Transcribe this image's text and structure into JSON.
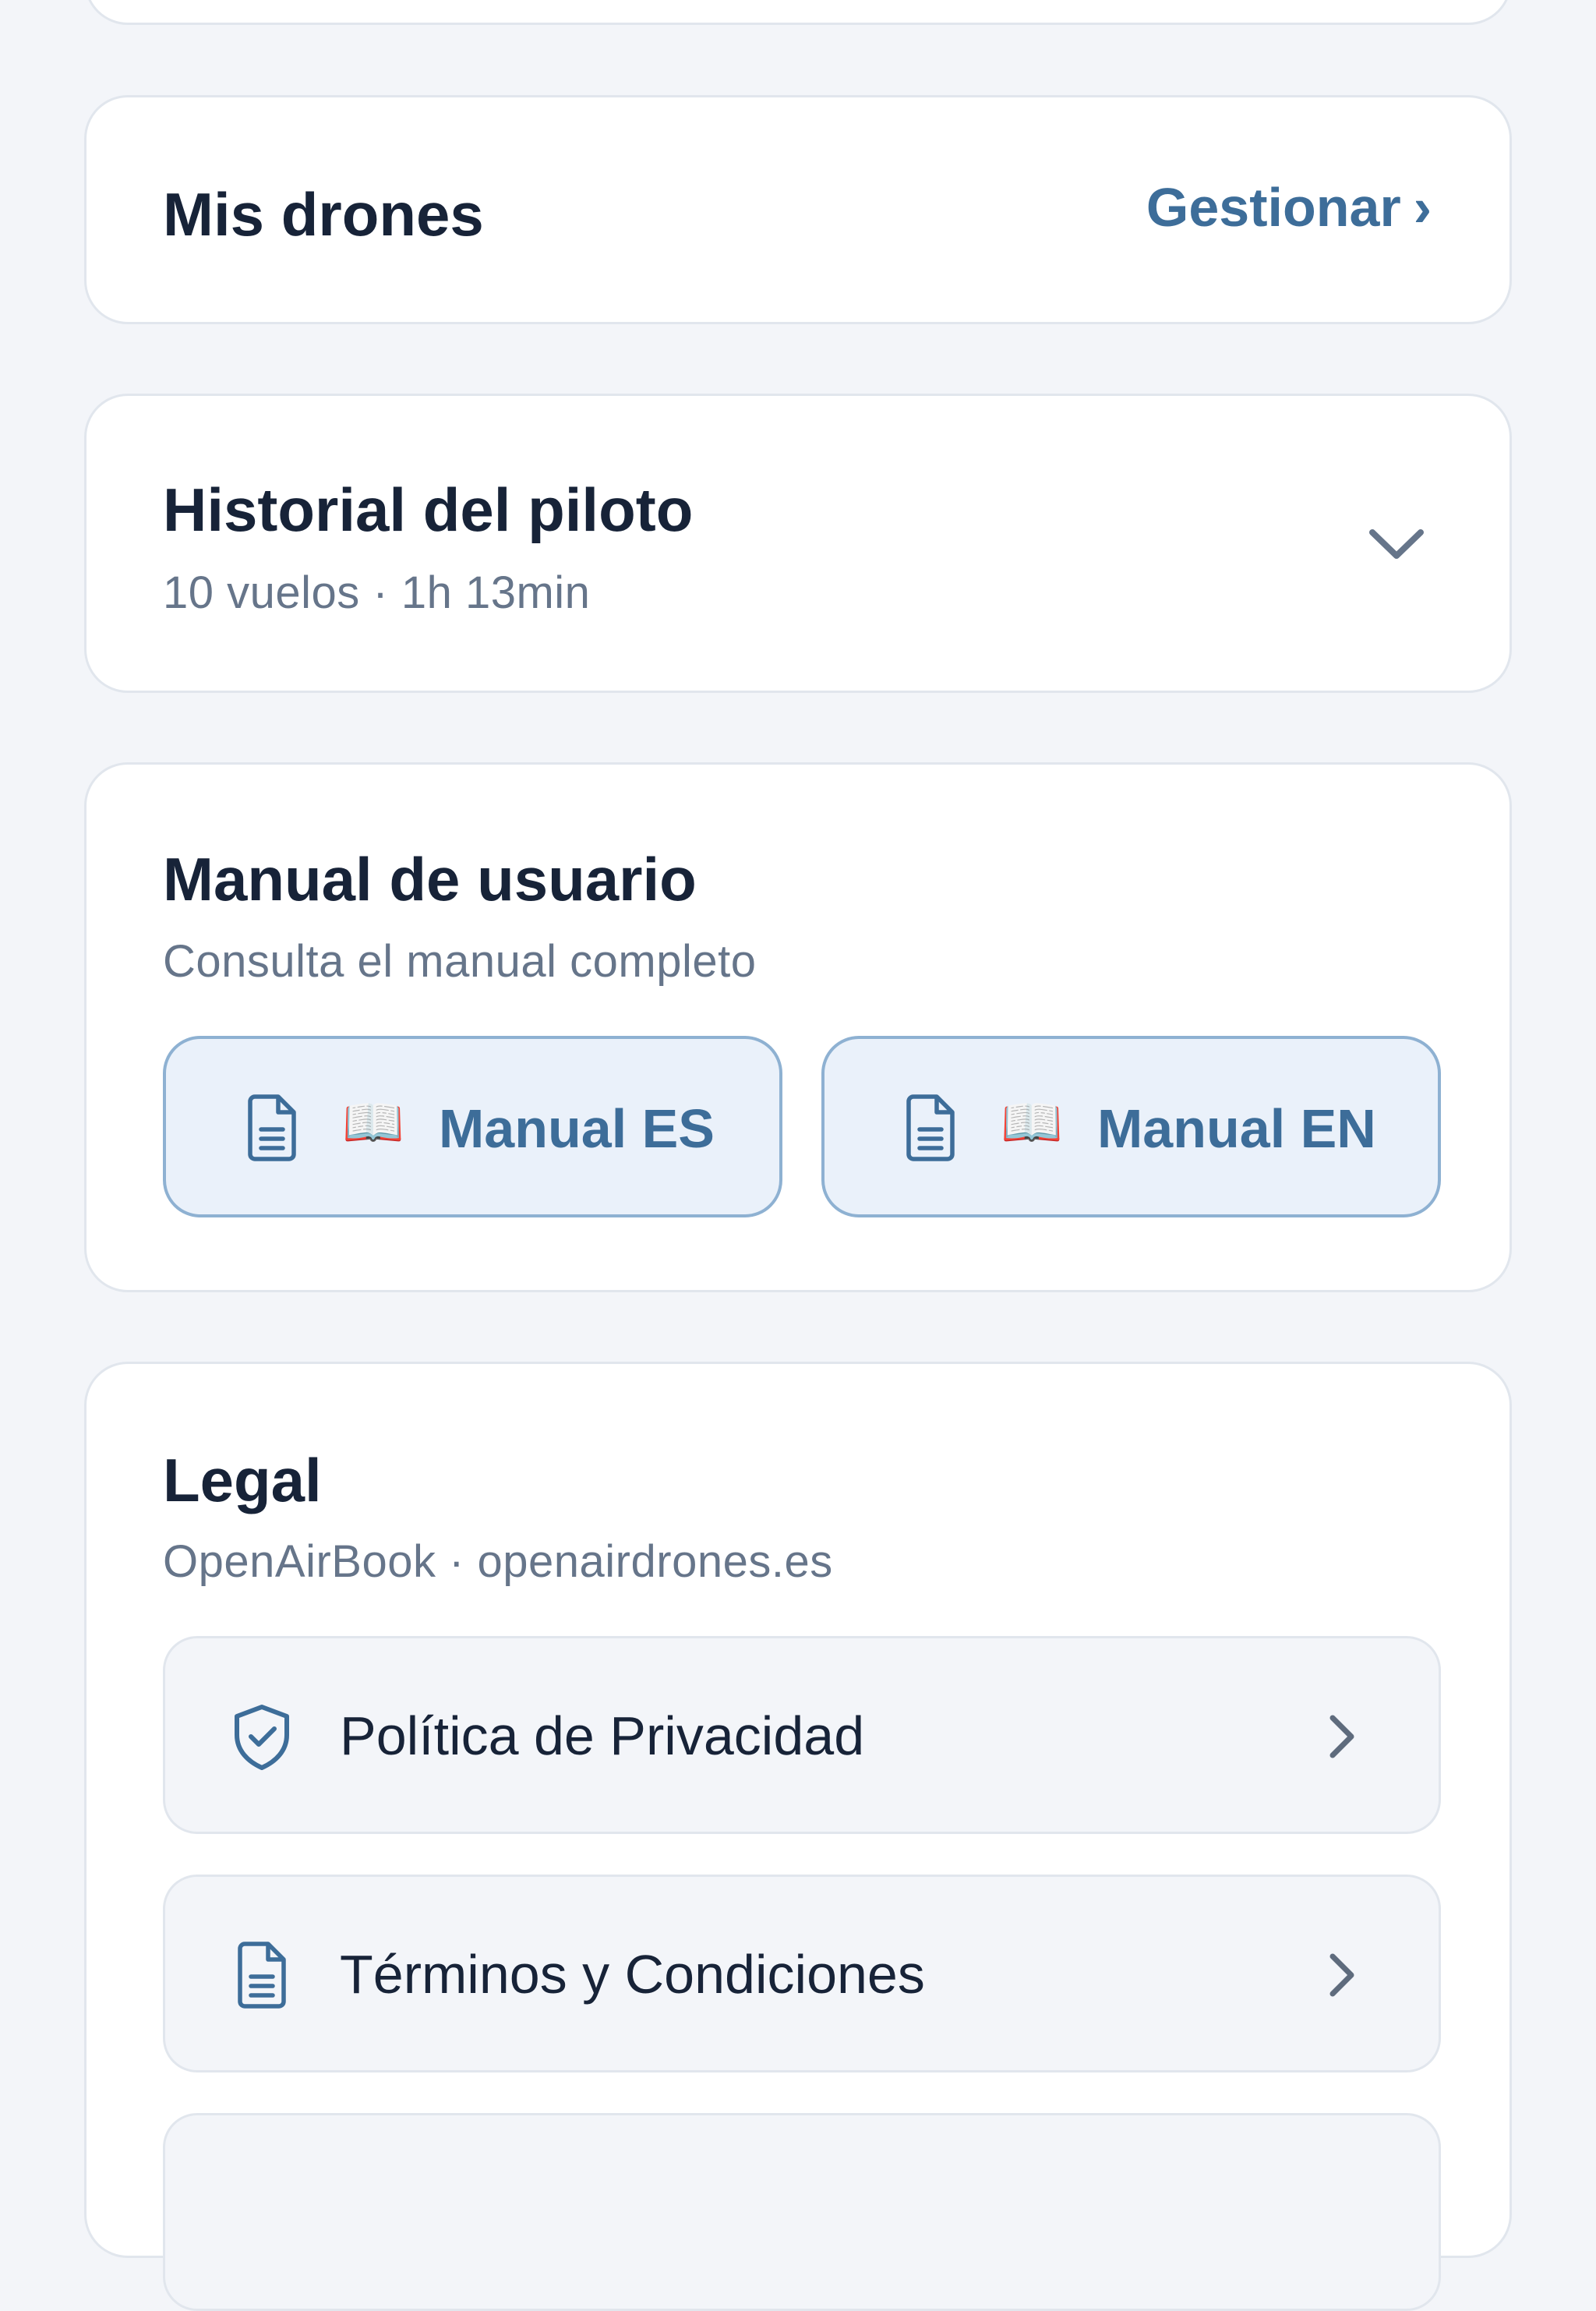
{
  "drones": {
    "title": "Mis drones",
    "manage_label": "Gestionar",
    "manage_chevron": "›"
  },
  "history": {
    "title": "Historial del piloto",
    "summary": "10 vuelos · 1h 13min",
    "toggle_icon": "chevron-down-icon"
  },
  "manual": {
    "title": "Manual de usuario",
    "subtitle": "Consulta el manual completo",
    "buttons": [
      {
        "emoji": "📖",
        "label": "Manual ES",
        "icon": "document-icon"
      },
      {
        "emoji": "📖",
        "label": "Manual EN",
        "icon": "document-icon"
      }
    ]
  },
  "legal": {
    "title": "Legal",
    "subtitle": "OpenAirBook · openairdrones.es",
    "items": [
      {
        "label": "Política de Privacidad",
        "icon": "shield-check-icon"
      },
      {
        "label": "Términos y Condiciones",
        "icon": "document-icon"
      }
    ]
  },
  "colors": {
    "background": "#f3f5f9",
    "card": "#ffffff",
    "accent": "#3d6d99",
    "text": "#172338",
    "muted": "#66758a"
  }
}
